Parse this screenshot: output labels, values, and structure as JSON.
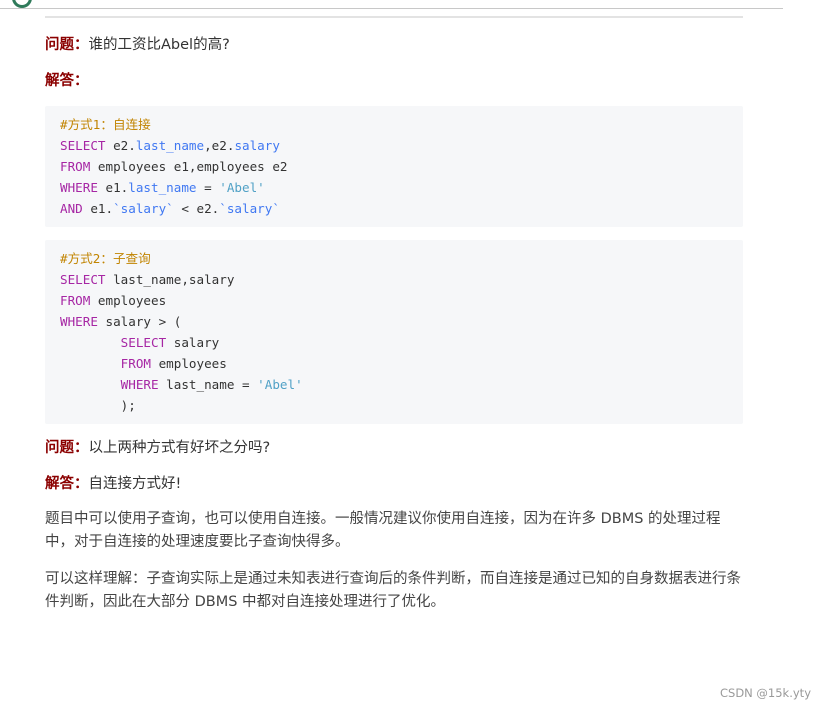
{
  "q1": {
    "label": "问题：",
    "text": "谁的工资比Abel的高?"
  },
  "a1": {
    "label": "解答："
  },
  "code1": {
    "comment": "#方式1：自连接",
    "l1": {
      "kw": "SELECT",
      "t1": " e2.",
      "a1": "last_name",
      "t2": ",e2.",
      "a2": "salary"
    },
    "l2": {
      "kw": "FROM",
      "t": " employees e1,employees e2"
    },
    "l3": {
      "kw": "WHERE",
      "t1": " e1.",
      "a1": "last_name",
      "t2": " = ",
      "s": "'Abel'"
    },
    "l4": {
      "kw": "AND",
      "t1": " e1.",
      "a1": "`salary`",
      "t2": " < e2.",
      "a2": "`salary`"
    }
  },
  "code2": {
    "comment": "#方式2：子查询",
    "l1": {
      "kw": "SELECT",
      "t": " last_name,salary"
    },
    "l2": {
      "kw": "FROM",
      "t": " employees"
    },
    "l3": {
      "kw": "WHERE",
      "t": " salary > ("
    },
    "l4": {
      "kw": "SELECT",
      "t": " salary"
    },
    "l5": {
      "kw": "FROM",
      "t": " employees"
    },
    "l6": {
      "kw": "WHERE",
      "t1": " last_name = ",
      "s": "'Abel'"
    },
    "l7": {
      "t": ");"
    }
  },
  "q2": {
    "label": "问题：",
    "text": "以上两种方式有好坏之分吗?"
  },
  "a2": {
    "label": "解答：",
    "text": "自连接方式好!"
  },
  "p1": "题目中可以使用子查询，也可以使用自连接。一般情况建议你使用自连接，因为在许多 DBMS 的处理过程中，对于自连接的处理速度要比子查询快得多。",
  "p2": "可以这样理解：子查询实际上是通过未知表进行查询后的条件判断，而自连接是通过已知的自身数据表进行条件判断，因此在大部分 DBMS 中都对自连接处理进行了优化。",
  "footer": "CSDN @15k.yty"
}
